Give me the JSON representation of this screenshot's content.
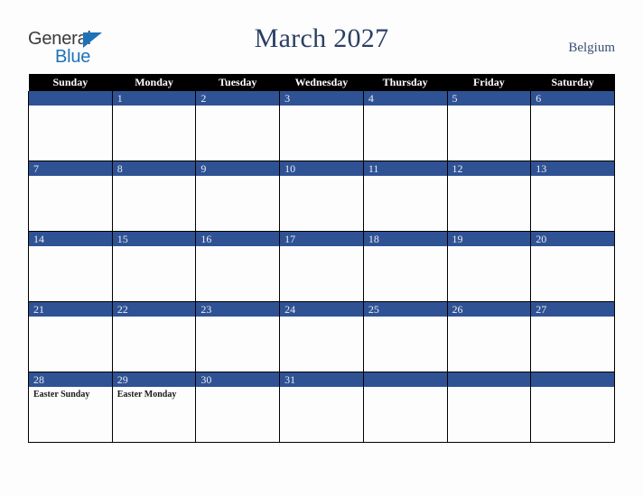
{
  "brand": {
    "word_one": "General",
    "word_two": "Blue",
    "triangle_icon": "blue-triangle-icon",
    "general_color": "#3a3a3a",
    "blue_color": "#1d72b8"
  },
  "header": {
    "title": "March 2027",
    "country": "Belgium",
    "title_color": "#2b3f63",
    "country_color": "#3b4f74"
  },
  "theme": {
    "page_background": "#fdfdfd",
    "weekday_header_background": "#000000",
    "weekday_header_text": "#ffffff",
    "day_band_background": "#2f5294",
    "day_number_text": "#e9ecf2",
    "grid_line": "#000000",
    "cell_background": "#fdfdfd",
    "event_text": "#1a1a1a"
  },
  "weekdays": [
    "Sunday",
    "Monday",
    "Tuesday",
    "Wednesday",
    "Thursday",
    "Friday",
    "Saturday"
  ],
  "weeks": [
    [
      {
        "number": "",
        "events": []
      },
      {
        "number": "1",
        "events": []
      },
      {
        "number": "2",
        "events": []
      },
      {
        "number": "3",
        "events": []
      },
      {
        "number": "4",
        "events": []
      },
      {
        "number": "5",
        "events": []
      },
      {
        "number": "6",
        "events": []
      }
    ],
    [
      {
        "number": "7",
        "events": []
      },
      {
        "number": "8",
        "events": []
      },
      {
        "number": "9",
        "events": []
      },
      {
        "number": "10",
        "events": []
      },
      {
        "number": "11",
        "events": []
      },
      {
        "number": "12",
        "events": []
      },
      {
        "number": "13",
        "events": []
      }
    ],
    [
      {
        "number": "14",
        "events": []
      },
      {
        "number": "15",
        "events": []
      },
      {
        "number": "16",
        "events": []
      },
      {
        "number": "17",
        "events": []
      },
      {
        "number": "18",
        "events": []
      },
      {
        "number": "19",
        "events": []
      },
      {
        "number": "20",
        "events": []
      }
    ],
    [
      {
        "number": "21",
        "events": []
      },
      {
        "number": "22",
        "events": []
      },
      {
        "number": "23",
        "events": []
      },
      {
        "number": "24",
        "events": []
      },
      {
        "number": "25",
        "events": []
      },
      {
        "number": "26",
        "events": []
      },
      {
        "number": "27",
        "events": []
      }
    ],
    [
      {
        "number": "28",
        "events": [
          "Easter Sunday"
        ]
      },
      {
        "number": "29",
        "events": [
          "Easter Monday"
        ]
      },
      {
        "number": "30",
        "events": []
      },
      {
        "number": "31",
        "events": []
      },
      {
        "number": "",
        "events": []
      },
      {
        "number": "",
        "events": []
      },
      {
        "number": "",
        "events": []
      }
    ]
  ]
}
